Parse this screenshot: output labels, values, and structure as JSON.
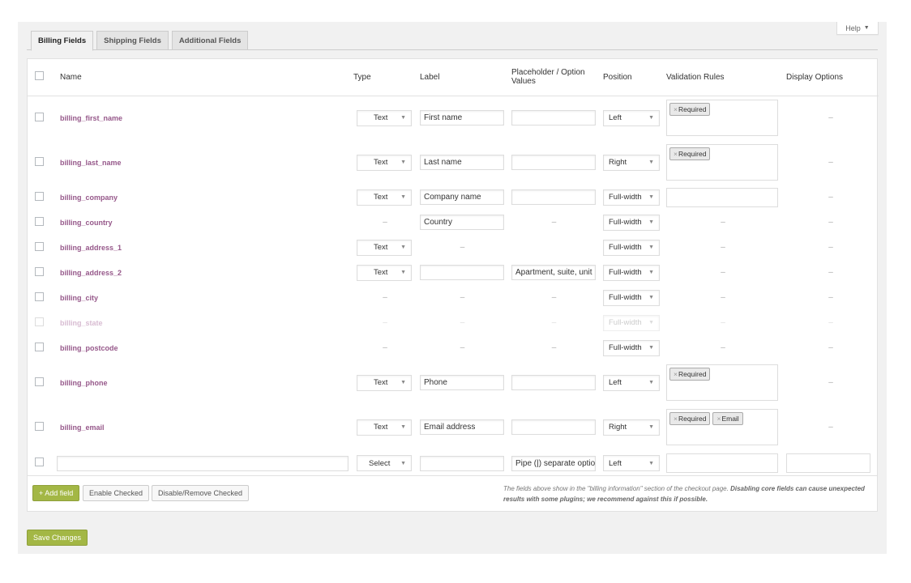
{
  "help": {
    "label": "Help"
  },
  "tabs": [
    {
      "label": "Billing Fields"
    },
    {
      "label": "Shipping Fields"
    },
    {
      "label": "Additional Fields"
    }
  ],
  "columns": {
    "name": "Name",
    "type": "Type",
    "label": "Label",
    "placeholder": "Placeholder / Option Values",
    "position": "Position",
    "validation": "Validation Rules",
    "display": "Display Options"
  },
  "dash": "–",
  "rows": [
    {
      "name": "billing_first_name",
      "type": "Text",
      "label": "First name",
      "placeholder": "",
      "position": "Left",
      "validation": [
        "Required"
      ],
      "display": "–"
    },
    {
      "name": "billing_last_name",
      "type": "Text",
      "label": "Last name",
      "placeholder": "",
      "position": "Right",
      "validation": [
        "Required"
      ],
      "display": "–"
    },
    {
      "name": "billing_company",
      "type": "Text",
      "label": "Company name",
      "placeholder": "",
      "position": "Full-width",
      "validation": [],
      "display": "–"
    },
    {
      "name": "billing_country",
      "type": "–",
      "label": "Country",
      "placeholder": "–",
      "position": "Full-width",
      "validation": "–",
      "display": "–"
    },
    {
      "name": "billing_address_1",
      "type": "Text",
      "label": "–",
      "placeholder": "",
      "position": "Full-width",
      "validation": "–",
      "display": "–"
    },
    {
      "name": "billing_address_2",
      "type": "Text",
      "label": "",
      "placeholder": "Apartment, suite, unit",
      "position": "Full-width",
      "validation": "–",
      "display": "–"
    },
    {
      "name": "billing_city",
      "type": "–",
      "label": "–",
      "placeholder": "–",
      "position": "Full-width",
      "validation": "–",
      "display": "–"
    },
    {
      "name": "billing_state",
      "type": "–",
      "label": "–",
      "placeholder": "–",
      "position": "Full-width",
      "validation": "–",
      "display": "–"
    },
    {
      "name": "billing_postcode",
      "type": "–",
      "label": "–",
      "placeholder": "–",
      "position": "Full-width",
      "validation": "–",
      "display": "–"
    },
    {
      "name": "billing_phone",
      "type": "Text",
      "label": "Phone",
      "placeholder": "",
      "position": "Left",
      "validation": [
        "Required"
      ],
      "display": "–"
    },
    {
      "name": "billing_email",
      "type": "Text",
      "label": "Email address",
      "placeholder": "",
      "position": "Right",
      "validation": [
        "Required",
        "Email"
      ],
      "display": "–"
    }
  ],
  "new_row": {
    "name": "",
    "type": "Select",
    "label": "",
    "placeholder": "Pipe (|) separate optio",
    "position": "Left"
  },
  "footer": {
    "add_field": "+ Add field",
    "enable_checked": "Enable Checked",
    "disable_checked": "Disable/Remove Checked",
    "note_a": "The fields above show in the \"billing information\" section of the checkout page.",
    "note_b": "Disabling core fields can cause unexpected results with some plugins; we recommend against this if possible."
  },
  "save": {
    "label": "Save Changes"
  }
}
